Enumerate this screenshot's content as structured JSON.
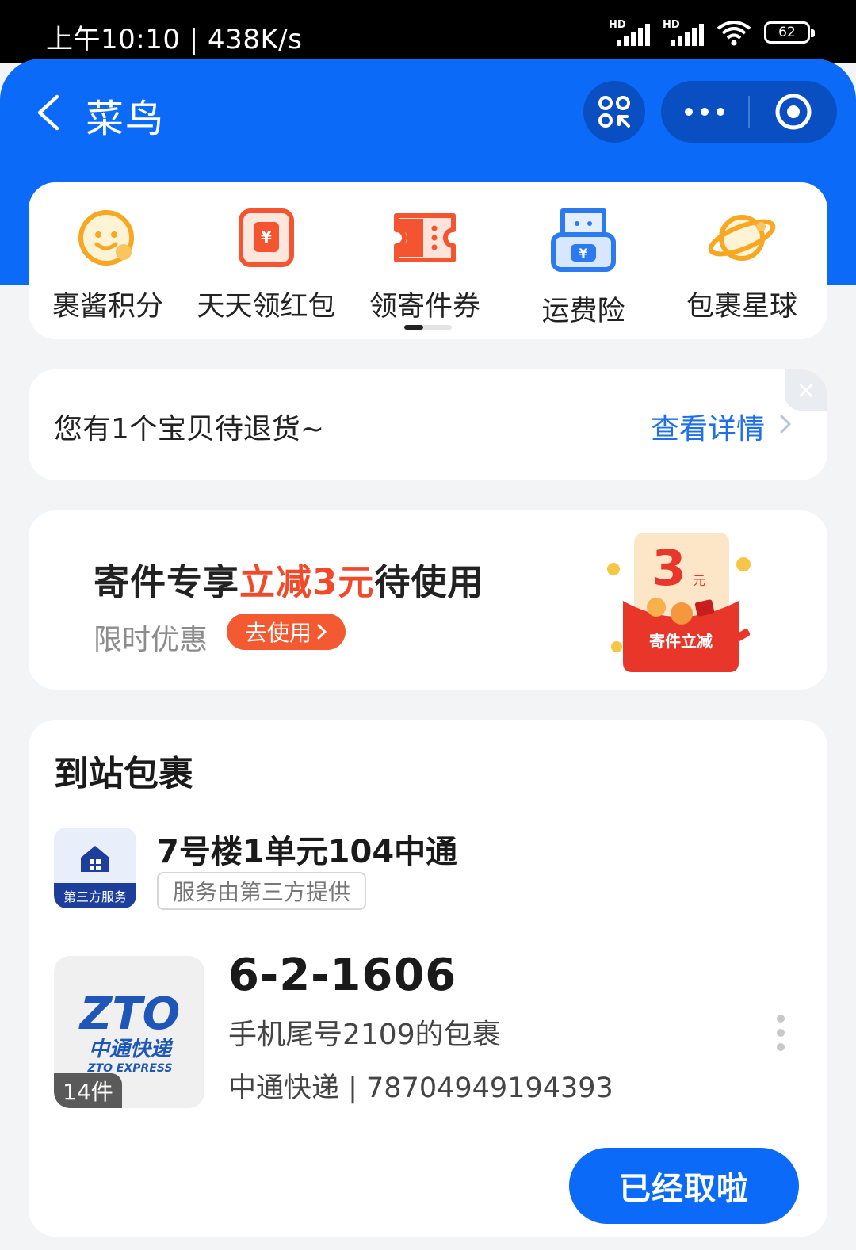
{
  "status_bar": {
    "time": "上午10:10 | 438K/s",
    "signal1_label": "HD",
    "signal2_label": "HD",
    "battery": "62"
  },
  "header": {
    "title": "菜鸟"
  },
  "quick_actions": [
    {
      "label": "裹酱积分",
      "icon": "smiley-icon"
    },
    {
      "label": "天天领红包",
      "icon": "red-envelope-icon"
    },
    {
      "label": "领寄件券",
      "icon": "ticket-icon"
    },
    {
      "label": "运费险",
      "icon": "insurance-icon"
    },
    {
      "label": "包裹星球",
      "icon": "planet-icon"
    }
  ],
  "notice": {
    "text": "您有1个宝贝待退货~",
    "link": "查看详情",
    "close": "×"
  },
  "promo": {
    "title_prefix": "寄件专享",
    "title_highlight": "立减3元",
    "title_suffix": "待使用",
    "subtitle": "限时优惠",
    "button": "去使用",
    "badge_amount": "3",
    "badge_unit": "元",
    "badge_caption": "寄件立减"
  },
  "parcels": {
    "section_title": "到站包裹",
    "station": {
      "logo_tag": "第三方服务",
      "name": "7号楼1单元104中通",
      "note": "服务由第三方提供"
    },
    "item": {
      "logo_text": "ZTO",
      "logo_cn": "中通快递",
      "logo_en": "ZTO EXPRESS",
      "count": "14件",
      "pickup_code": "6-2-1606",
      "description": "手机尾号2109的包裹",
      "tracking": "中通快递 | 78704949194393",
      "action": "已经取啦"
    }
  },
  "colors": {
    "brand_blue": "#0c6af8",
    "promo_red": "#f04a2a",
    "link_blue": "#1f6fe6"
  }
}
